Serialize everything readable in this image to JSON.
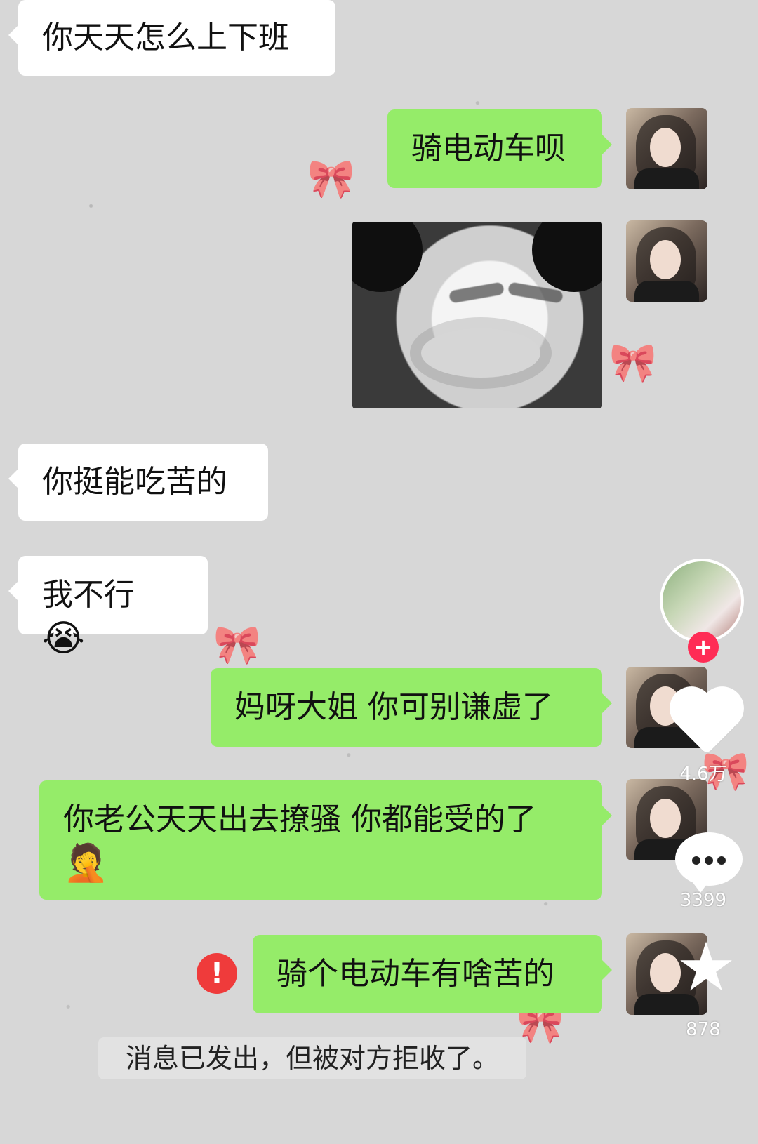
{
  "messages": {
    "m1": "你天天怎么上下班",
    "m2": "骑电动车呗",
    "m4": "你挺能吃苦的",
    "m5_text": "我不行",
    "m5_emoji": "😭",
    "m6": "妈呀大姐 你可别谦虚了",
    "m7_text": "你老公天天出去撩骚 你都能受的了",
    "m7_emoji": "🤦",
    "m8": "骑个电动车有啥苦的"
  },
  "sidebar": {
    "likes_count": "4.6万",
    "comments_count": "3399",
    "favorites_count": "878"
  },
  "status": {
    "error_mark": "!",
    "system_message": "消息已发出，但被对方拒收了。"
  },
  "icons": {
    "bow": "bow-icon",
    "heart": "heart-icon",
    "comment": "comment-icon",
    "star": "star-icon",
    "add": "plus-icon"
  },
  "colors": {
    "right_bubble": "#95ec69",
    "left_bubble": "#ffffff",
    "background": "#d7d7d7",
    "error": "#ef3b3b",
    "follow": "#ff2c55"
  }
}
